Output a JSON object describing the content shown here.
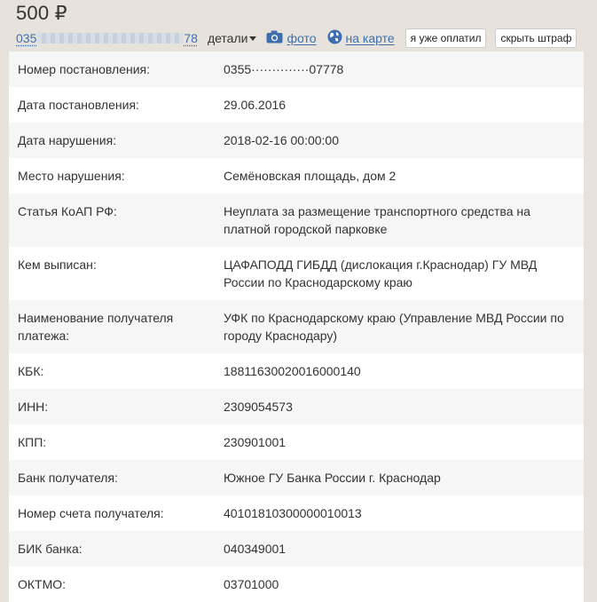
{
  "fine": {
    "amount": "500 ₽",
    "uin_prefix": "035",
    "uin_suffix": "78",
    "details_label": "детали",
    "photo_label": "фото",
    "map_label": "на карте",
    "paid_button": "я уже оплатил",
    "hide_button": "скрыть штраф"
  },
  "icons": {
    "photo": "camera-icon",
    "map": "globe-icon",
    "details": "caret-down-icon"
  },
  "colors": {
    "link": "#3d6fb0",
    "background": "#e7e3dc",
    "row_alt": "#f6f6f6"
  },
  "rows": [
    {
      "label": "Номер постановления:",
      "value": "0355··············07778"
    },
    {
      "label": "Дата постановления:",
      "value": "29.06.2016"
    },
    {
      "label": "Дата нарушения:",
      "value": "2018-02-16 00:00:00"
    },
    {
      "label": "Место нарушения:",
      "value": "Семёновская площадь, дом 2"
    },
    {
      "label": "Статья КоАП РФ:",
      "value": "Неуплата за размещение транспортного средства на платной городской парковке"
    },
    {
      "label": "Кем выписан:",
      "value": "ЦАФАПОДД ГИБДД (дислокация г.Краснодар) ГУ МВД России по Краснодарскому краю"
    },
    {
      "label": "Наименование получателя платежа:",
      "value": "УФК по Краснодарскому краю (Управление МВД России по городу Краснодару)"
    },
    {
      "label": "КБК:",
      "value": "18811630020016000140"
    },
    {
      "label": "ИНН:",
      "value": "2309054573"
    },
    {
      "label": "КПП:",
      "value": "230901001"
    },
    {
      "label": "Банк получателя:",
      "value": "Южное ГУ Банка России г. Краснодар"
    },
    {
      "label": "Номер счета получателя:",
      "value": "40101810300000010013"
    },
    {
      "label": "БИК банка:",
      "value": "040349001"
    },
    {
      "label": "ОКТМО:",
      "value": "03701000"
    }
  ]
}
